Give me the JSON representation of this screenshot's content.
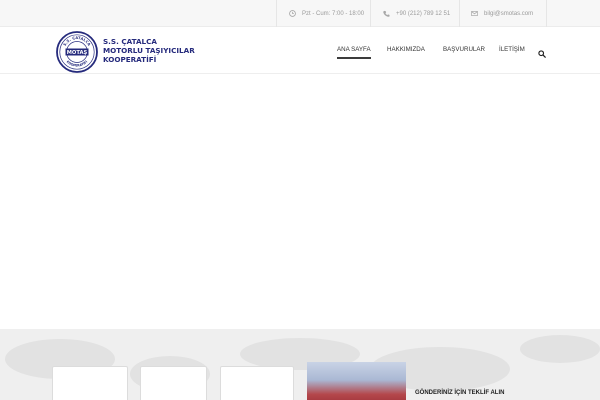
{
  "topbar": {
    "hours": "Pzt - Cum: 7:00 - 18:00",
    "phone": "+90 (212) 789 12 51",
    "email": "bilgi@smotas.com",
    "icons": [
      "clock-icon",
      "phone-icon",
      "envelope-icon"
    ]
  },
  "brand": {
    "seal_top": "S.S. ÇATALCA",
    "seal_center": "MOTAŞ",
    "seal_bottom": "KOOPERATİFİ",
    "lines": [
      "S.S. ÇATALCA",
      "MOTORLU TAŞIYICILAR",
      "KOOPERATİFİ"
    ],
    "color": "#252a7c"
  },
  "nav": {
    "items": [
      {
        "label": "ANA SAYFA",
        "active": true
      },
      {
        "label": "HAKKIMIZDA",
        "active": false
      },
      {
        "label": "BAŞVURULAR",
        "active": false
      },
      {
        "label": "İLETİŞİM",
        "active": false
      }
    ],
    "search_icon": "search-icon"
  },
  "footer": {
    "quote_title": "GÖNDERİNİZ İÇİN TEKLİF ALIN"
  }
}
